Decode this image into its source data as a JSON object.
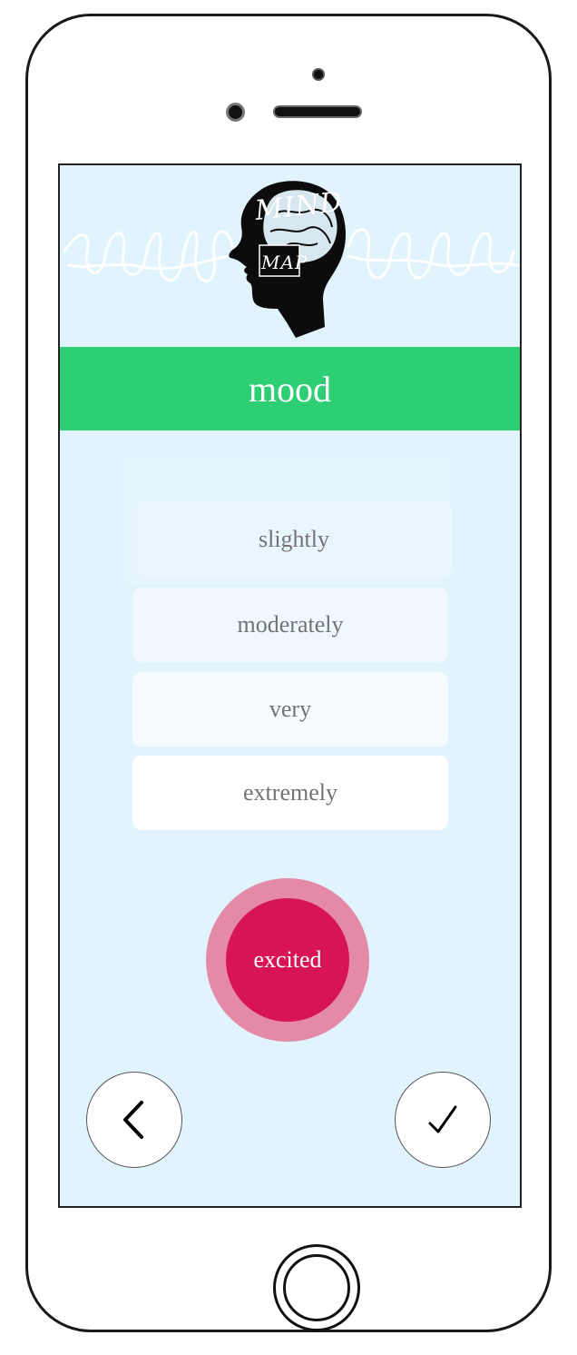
{
  "app": {
    "logo_line_1": "MIND",
    "logo_line_2": "MAP"
  },
  "header": {
    "title": "mood"
  },
  "intensity_options": [
    {
      "label": "slightly"
    },
    {
      "label": "moderately"
    },
    {
      "label": "very"
    },
    {
      "label": "extremely"
    }
  ],
  "selected_mood": {
    "label": "excited",
    "color_inner": "#d81458",
    "color_outer": "#e48aa6"
  },
  "navigation": {
    "back_icon": "chevron-left-icon",
    "confirm_icon": "checkmark-icon"
  },
  "colors": {
    "screen_background": "#e1f3fd",
    "title_bar": "#2ecf74"
  }
}
